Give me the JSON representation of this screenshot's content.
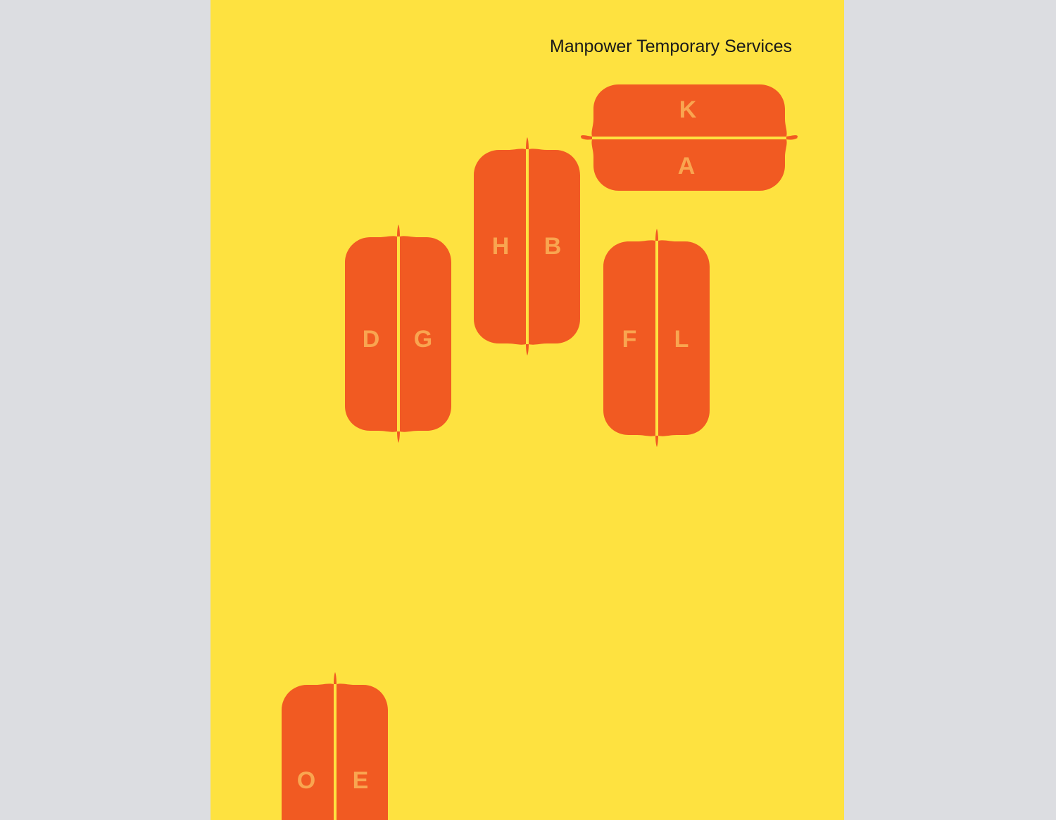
{
  "poster": {
    "title": "Manpower Temporary Services",
    "colors": {
      "background": "#fee240",
      "shape": "#f15a22",
      "letter": "#f9a550",
      "title": "#1a1a1a",
      "surround": "#dcdde1"
    }
  },
  "pods": {
    "ka": {
      "first": "K",
      "second": "A"
    },
    "hb": {
      "first": "H",
      "second": "B"
    },
    "dg": {
      "first": "D",
      "second": "G"
    },
    "fl": {
      "first": "F",
      "second": "L"
    },
    "oe": {
      "first": "O",
      "second": "E"
    }
  }
}
